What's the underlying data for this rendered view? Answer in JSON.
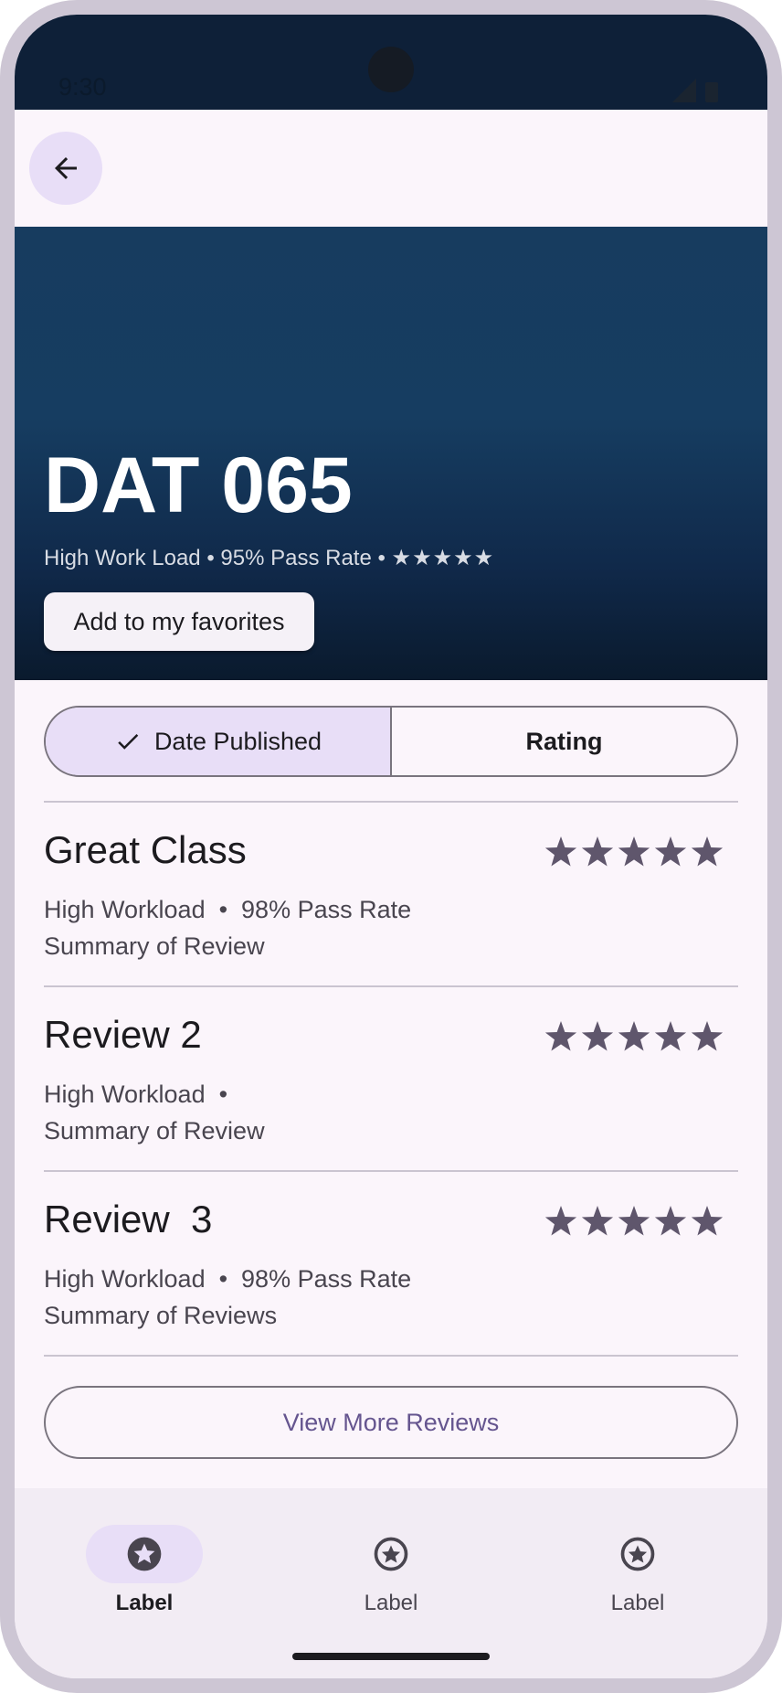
{
  "status_bar": {
    "time": "9:30"
  },
  "app_bar": {
    "back_icon": "arrow-back-icon"
  },
  "hero": {
    "title": "DAT 065",
    "subtitle_text": "High Work Load • 95% Pass Rate • ",
    "subtitle_stars": "★★★★★",
    "favorite_button": "Add to my favorites"
  },
  "sort": {
    "options": [
      {
        "label": "Date Published",
        "selected": true
      },
      {
        "label": "Rating",
        "selected": false
      }
    ]
  },
  "reviews": [
    {
      "title": "Great Class",
      "meta": "High Workload  •  98% Pass Rate",
      "summary": "Summary of Review",
      "stars": 5
    },
    {
      "title": "Review 2",
      "meta": "High Workload  •",
      "summary": "Summary of Review",
      "stars": 5
    },
    {
      "title": "Review  3",
      "meta": "High Workload  •  98% Pass Rate",
      "summary": "Summary of Reviews",
      "stars": 5
    }
  ],
  "view_more": "View More Reviews",
  "bottom_nav": {
    "items": [
      {
        "label": "Label",
        "icon": "star-circle-icon",
        "active": true
      },
      {
        "label": "Label",
        "icon": "star-circle-icon",
        "active": false
      },
      {
        "label": "Label",
        "icon": "star-circle-icon",
        "active": false
      }
    ]
  },
  "colors": {
    "hero_top": "#173c5f",
    "hero_bottom": "#0a1a2d",
    "accent_container": "#e8def7",
    "accent_text": "#65558f",
    "star": "#5f566c"
  }
}
